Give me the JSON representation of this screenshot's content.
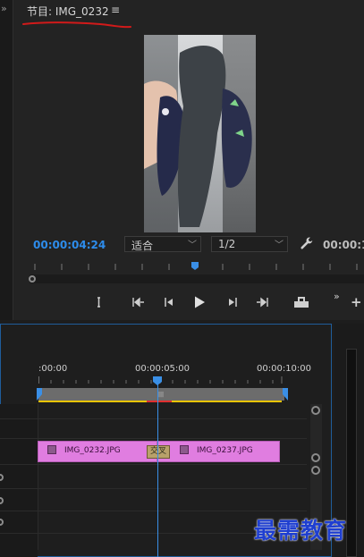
{
  "program_monitor": {
    "tab_title": "节目: IMG_0232",
    "menu_icon": "hamburger-menu-icon",
    "current_timecode": "00:00:04:24",
    "fit_label": "适合",
    "resolution_label": "1/2",
    "duration_timecode": "00:00:1",
    "transport_icons": [
      "mark-in-icon",
      "go-to-in-icon",
      "step-back-icon",
      "play-icon",
      "step-forward-icon",
      "go-to-out-icon",
      "export-frame-icon",
      "more-icon",
      "add-button"
    ]
  },
  "timeline": {
    "ruler_labels": [
      ":00:00",
      "00:00:05:00",
      "00:00:10:00"
    ],
    "clips": [
      {
        "name": "IMG_0232.JPG"
      },
      {
        "name": "IMG_0237.JPG"
      }
    ],
    "transition_label": "交叉"
  },
  "watermark": "最需教育",
  "colors": {
    "timecode_blue": "#2d8ceb",
    "clip_pink": "#e07de0",
    "playhead": "#3a8fe6",
    "annotation_red": "#d11a1a",
    "watermark_blue": "#1f3fd0"
  }
}
